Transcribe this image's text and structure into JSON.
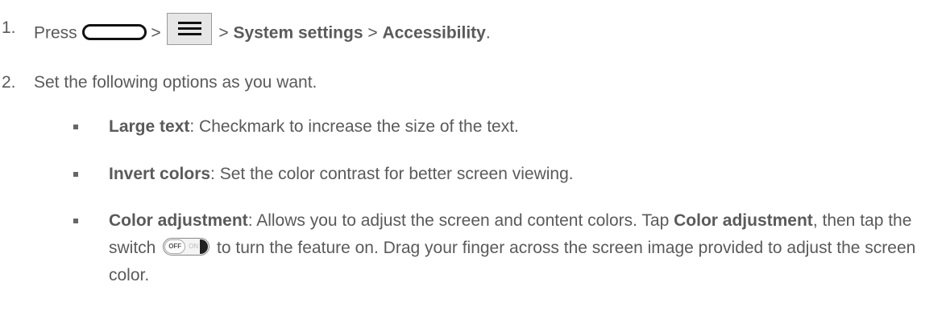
{
  "steps": [
    {
      "number": "1.",
      "press": "Press",
      "sep1": ">",
      "sep2": ">",
      "system_settings": "System settings",
      "sep3": ">",
      "accessibility": "Accessibility",
      "end": "."
    },
    {
      "number": "2.",
      "text": "Set the following options as you want."
    }
  ],
  "options": [
    {
      "title": "Large text",
      "description": ": Checkmark to increase the size of the text."
    },
    {
      "title": "Invert colors",
      "description": ": Set the color contrast for better screen viewing."
    },
    {
      "title": "Color adjustment",
      "desc_part1": ": Allows you to adjust the screen and content colors. Tap ",
      "tap_target": "Color adjustment",
      "desc_part2": ", then tap the switch ",
      "desc_part3": " to turn the feature on. Drag your finger across the screen image provided to adjust the screen color."
    }
  ],
  "switch": {
    "off_label": "OFF",
    "on_label": "ON"
  },
  "icons": {
    "home": "home-key-icon",
    "menu": "menu-key-icon",
    "switch": "toggle-switch-icon"
  }
}
